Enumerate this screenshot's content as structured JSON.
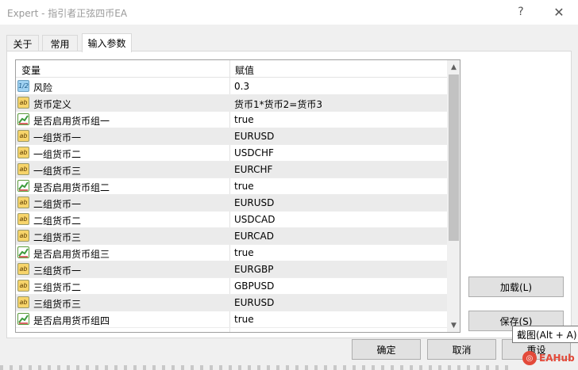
{
  "window": {
    "title": "Expert - 指引者正弦四币EA",
    "help_glyph": "?",
    "close_glyph": "✕"
  },
  "tabs": [
    {
      "label": "关于",
      "active": false
    },
    {
      "label": "常用",
      "active": false
    },
    {
      "label": "输入参数",
      "active": true
    }
  ],
  "grid": {
    "col_name": "变量",
    "col_value": "赋值",
    "rows": [
      {
        "icon": "number-icon",
        "name": "风险",
        "value": "0.3"
      },
      {
        "icon": "string-icon",
        "name": "货币定义",
        "value": "货币1*货币2=货币3"
      },
      {
        "icon": "bool-icon",
        "name": "是否启用货币组一",
        "value": "true"
      },
      {
        "icon": "string-icon",
        "name": "一组货币一",
        "value": "EURUSD"
      },
      {
        "icon": "string-icon",
        "name": "一组货币二",
        "value": "USDCHF"
      },
      {
        "icon": "string-icon",
        "name": "一组货币三",
        "value": "EURCHF"
      },
      {
        "icon": "bool-icon",
        "name": "是否启用货币组二",
        "value": "true"
      },
      {
        "icon": "string-icon",
        "name": "二组货币一",
        "value": "EURUSD"
      },
      {
        "icon": "string-icon",
        "name": "二组货币二",
        "value": "USDCAD"
      },
      {
        "icon": "string-icon",
        "name": "二组货币三",
        "value": "EURCAD"
      },
      {
        "icon": "bool-icon",
        "name": "是否启用货币组三",
        "value": "true"
      },
      {
        "icon": "string-icon",
        "name": "三组货币一",
        "value": "EURGBP"
      },
      {
        "icon": "string-icon",
        "name": "三组货币二",
        "value": "GBPUSD"
      },
      {
        "icon": "string-icon",
        "name": "三组货币三",
        "value": "EURUSD"
      },
      {
        "icon": "bool-icon",
        "name": "是否启用货币组四",
        "value": "true"
      }
    ],
    "icon_text": {
      "number": "1/2",
      "string": "ab"
    }
  },
  "buttons": {
    "load": "加载(L)",
    "save": "保存(S)",
    "ok": "确定",
    "cancel": "取消",
    "reset": "重设"
  },
  "tooltip": "截图(Alt + A)",
  "watermark": {
    "logo": "◎",
    "text": "EAHub"
  },
  "colors": {
    "accent_watermark": "#e34a3a",
    "row_alt": "#ebebeb",
    "bool_icon": "#3c9b3c"
  }
}
